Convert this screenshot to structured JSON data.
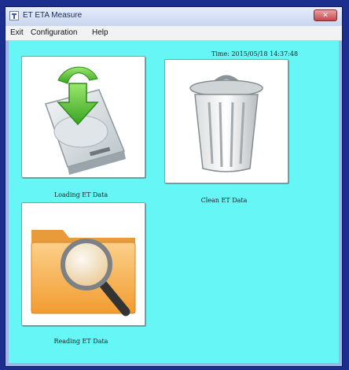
{
  "window": {
    "title": "ET ETA Measure",
    "close_glyph": "✕"
  },
  "menu": {
    "items": [
      "Exit",
      "Configuration",
      "Help"
    ]
  },
  "status": {
    "time": "Time: 2015/05/18 14:37:48"
  },
  "tiles": [
    {
      "label": "Loading ET Data",
      "icon": "download-drive-icon"
    },
    {
      "label": "Clean ET Data",
      "icon": "trash-can-icon"
    },
    {
      "label": "Reading ET Data",
      "icon": "folder-search-icon"
    }
  ],
  "colors": {
    "background_frame": "#1c2e8e",
    "client_area": "#66f6f5",
    "arrow_green": "#5cc43a",
    "folder_orange": "#f6b04a"
  }
}
